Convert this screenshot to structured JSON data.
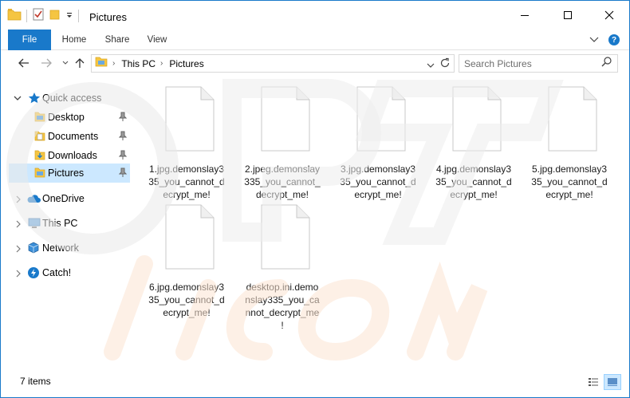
{
  "window": {
    "title": "Pictures"
  },
  "ribbon": {
    "tabs": [
      "File",
      "Home",
      "Share",
      "View"
    ]
  },
  "address": {
    "crumbs": [
      "This PC",
      "Pictures"
    ],
    "search_placeholder": "Search Pictures"
  },
  "navpane": {
    "quick_access": "Quick access",
    "items": [
      {
        "label": "Desktop",
        "icon": "desktop-folder-icon",
        "pinned": true
      },
      {
        "label": "Documents",
        "icon": "documents-folder-icon",
        "pinned": true
      },
      {
        "label": "Downloads",
        "icon": "downloads-folder-icon",
        "pinned": true
      },
      {
        "label": "Pictures",
        "icon": "pictures-folder-icon",
        "pinned": true,
        "selected": true
      }
    ],
    "roots": [
      {
        "label": "OneDrive",
        "icon": "onedrive-icon"
      },
      {
        "label": "This PC",
        "icon": "this-pc-icon"
      },
      {
        "label": "Network",
        "icon": "network-icon"
      },
      {
        "label": "Catch!",
        "icon": "catch-icon"
      }
    ]
  },
  "files": [
    {
      "name": "1.jpg.demonslay335_you_cannot_decrypt_me!",
      "lines": [
        "1.jpg.demonslay3",
        "35_you_cannot_d",
        "ecrypt_me!"
      ]
    },
    {
      "name": "2.jpeg.demonslay335_you_cannot_decrypt_me!",
      "lines": [
        "2.jpeg.demonslay",
        "335_you_cannot_",
        "decrypt_me!"
      ]
    },
    {
      "name": "3.jpg.demonslay335_you_cannot_decrypt_me!",
      "lines": [
        "3.jpg.demonslay3",
        "35_you_cannot_d",
        "ecrypt_me!"
      ]
    },
    {
      "name": "4.jpg.demonslay335_you_cannot_decrypt_me!",
      "lines": [
        "4.jpg.demonslay3",
        "35_you_cannot_d",
        "ecrypt_me!"
      ]
    },
    {
      "name": "5.jpg.demonslay335_you_cannot_decrypt_me!",
      "lines": [
        "5.jpg.demonslay3",
        "35_you_cannot_d",
        "ecrypt_me!"
      ]
    },
    {
      "name": "6.jpg.demonslay335_you_cannot_decrypt_me!",
      "lines": [
        "6.jpg.demonslay3",
        "35_you_cannot_d",
        "ecrypt_me!"
      ]
    },
    {
      "name": "desktop.ini.demonslay335_you_cannot_decrypt_me!",
      "lines": [
        "desktop.ini.demo",
        "nslay335_you_ca",
        "nnot_decrypt_me",
        "!"
      ]
    }
  ],
  "status": {
    "item_count": "7 items"
  },
  "colors": {
    "accent": "#1979ca",
    "selection": "#cce8ff",
    "folder": "#f5c542"
  }
}
